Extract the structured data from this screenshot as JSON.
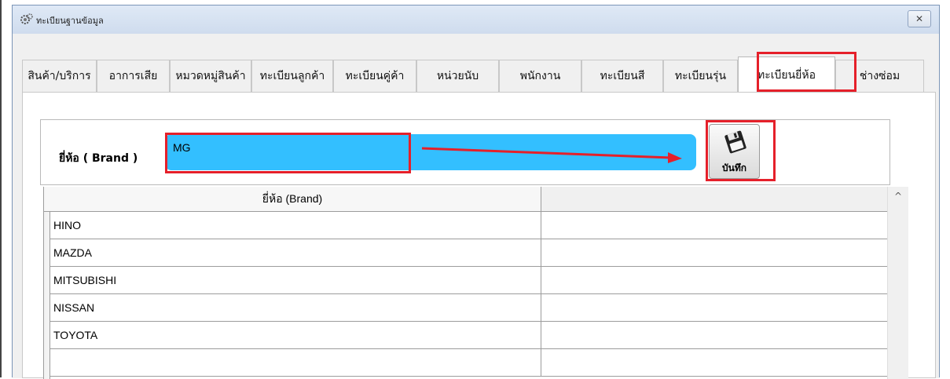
{
  "window": {
    "title": "ทะเบียนฐานข้อมูล",
    "close_icon": "close-icon"
  },
  "tabs": [
    {
      "label": "สินค้า/บริการ"
    },
    {
      "label": "อาการเสีย"
    },
    {
      "label": "หมวดหมู่สินค้า"
    },
    {
      "label": "ทะเบียนลูกค้า"
    },
    {
      "label": "ทะเบียนคู่ค้า"
    },
    {
      "label": "หน่วยนับ"
    },
    {
      "label": "พนักงาน"
    },
    {
      "label": "ทะเบียนสี"
    },
    {
      "label": "ทะเบียนรุ่น"
    },
    {
      "label": "ทะเบียนยี่ห้อ",
      "active": true
    },
    {
      "label": "ช่างซ่อม"
    }
  ],
  "brand_form": {
    "label": "ยี่ห้อ ( Brand )",
    "value": "MG",
    "save_label": "บันทึก",
    "input_color": "#33bfff",
    "highlight_color": "#e5202a"
  },
  "grid": {
    "column_header": "ยี่ห้อ (Brand)",
    "rows": [
      "HINO",
      "MAZDA",
      "MITSUBISHI",
      "NISSAN",
      "TOYOTA",
      ""
    ]
  }
}
